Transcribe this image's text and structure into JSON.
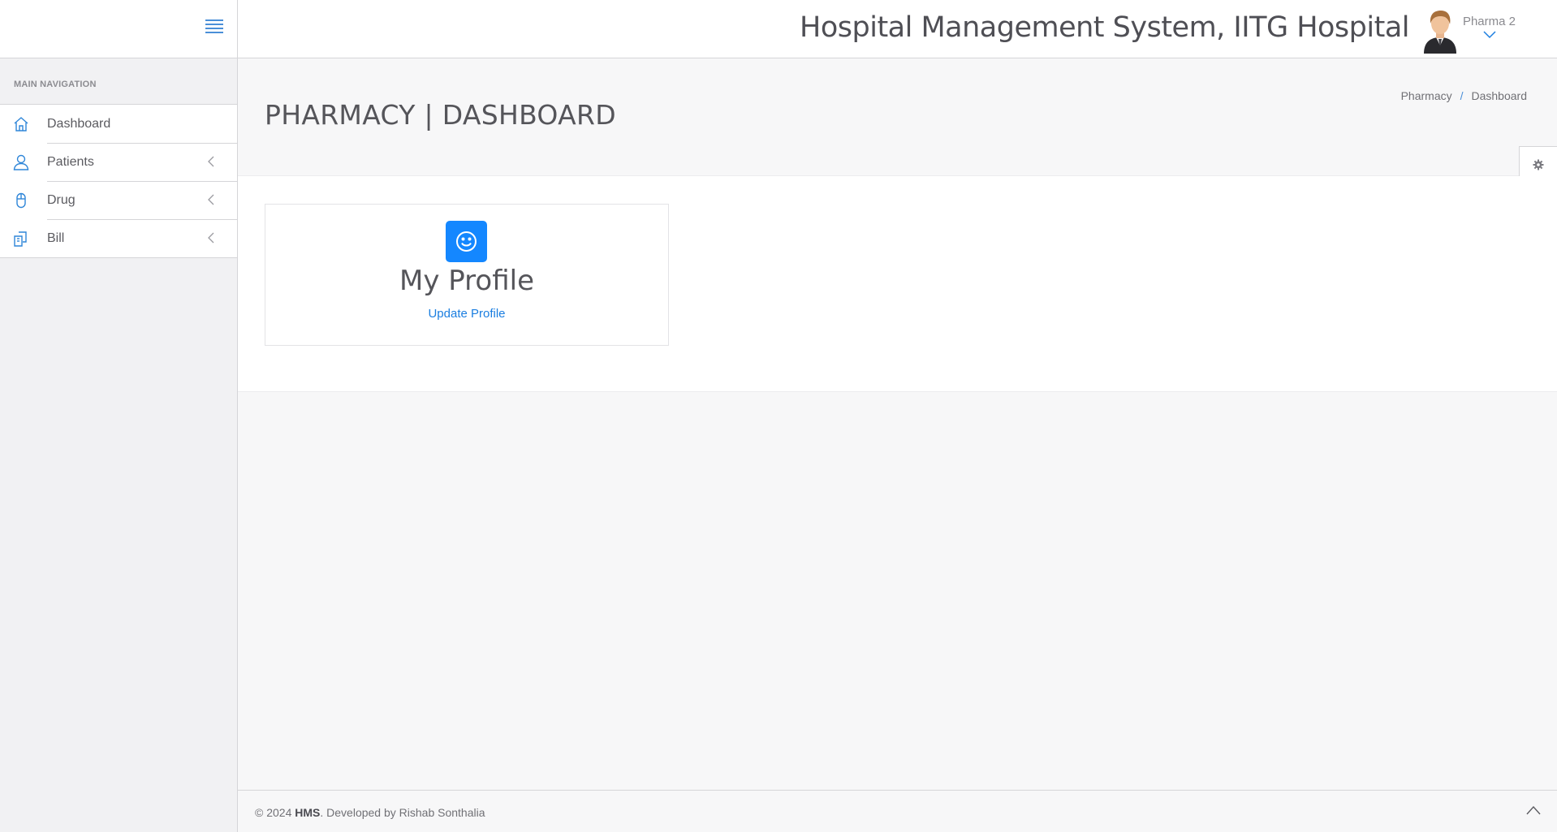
{
  "header": {
    "app_title": "Hospital Management System, IITG Hospital",
    "user_name": "Pharma 2"
  },
  "sidebar": {
    "nav_title": "MAIN NAVIGATION",
    "items": [
      {
        "label": "Dashboard",
        "icon": "home-icon",
        "has_submenu": false
      },
      {
        "label": "Patients",
        "icon": "user-icon",
        "has_submenu": true
      },
      {
        "label": "Drug",
        "icon": "mouse-icon",
        "has_submenu": true
      },
      {
        "label": "Bill",
        "icon": "files-icon",
        "has_submenu": true
      }
    ]
  },
  "page": {
    "title": "PHARMACY | DASHBOARD",
    "breadcrumb": [
      "Pharmacy",
      "Dashboard"
    ]
  },
  "card": {
    "icon": "smile-icon",
    "title": "My Profile",
    "link": "Update Profile"
  },
  "footer": {
    "prefix": "© 2024 ",
    "brand": "HMS",
    "suffix": ". Developed by Rishab Sonthalia"
  },
  "colors": {
    "accent": "#1487ff",
    "link": "#1b7ee0",
    "sidebar_bg": "#f1f1f3"
  }
}
